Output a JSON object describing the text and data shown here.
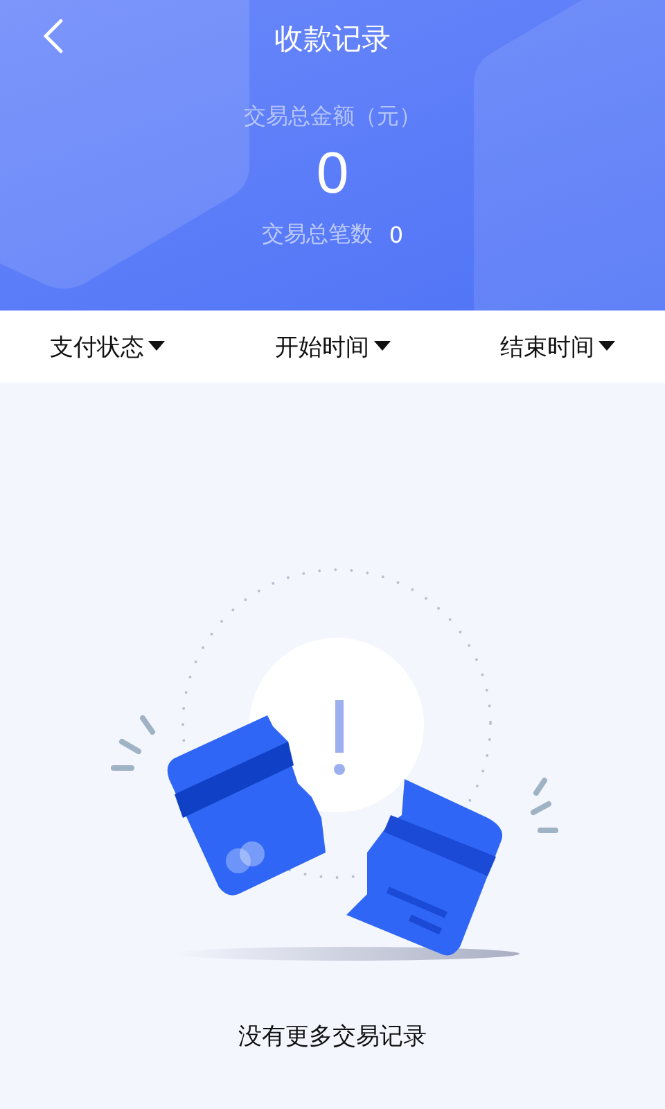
{
  "header": {
    "title": "收款记录",
    "amount_label": "交易总金额（元）",
    "amount": "0",
    "count_label": "交易总笔数",
    "count": "0"
  },
  "filters": [
    {
      "label": "支付状态"
    },
    {
      "label": "开始时间"
    },
    {
      "label": "结束时间"
    }
  ],
  "empty_state": {
    "message": "没有更多交易记录"
  }
}
